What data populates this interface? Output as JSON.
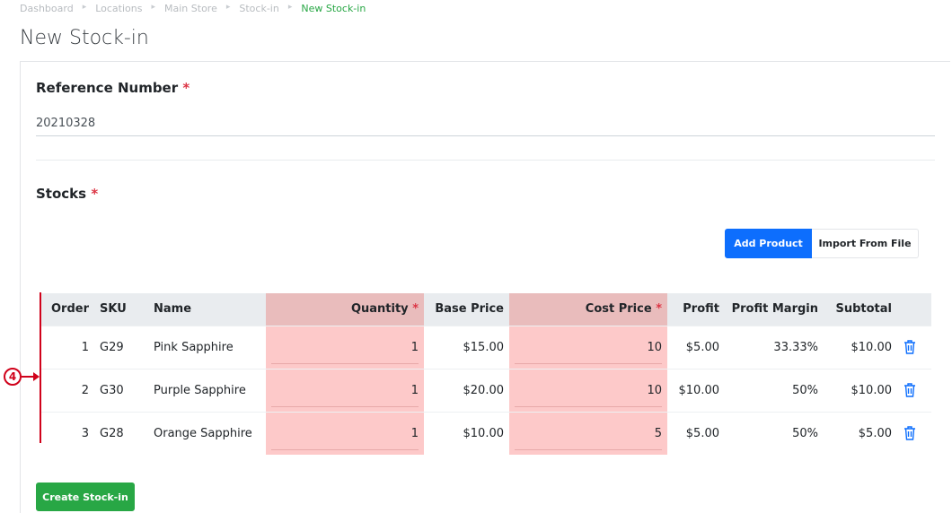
{
  "breadcrumb": [
    "Dashboard",
    "Locations",
    "Main Store",
    "Stock-in",
    "New Stock-in"
  ],
  "page_title": "New Stock-in",
  "form": {
    "reference_label": "Reference Number",
    "reference_value": "20210328",
    "stocks_label": "Stocks",
    "required_mark": "*"
  },
  "buttons": {
    "add_product": "Add Product",
    "import_file": "Import From File",
    "create": "Create Stock-in"
  },
  "table": {
    "headers": {
      "order": "Order",
      "sku": "SKU",
      "name": "Name",
      "quantity": "Quantity",
      "base_price": "Base Price",
      "cost_price": "Cost Price",
      "profit": "Profit",
      "profit_margin": "Profit Margin",
      "subtotal": "Subtotal"
    },
    "rows": [
      {
        "order": "1",
        "sku": "G29",
        "name": "Pink Sapphire",
        "quantity": "1",
        "base_price": "$15.00",
        "cost_price": "10",
        "profit": "$5.00",
        "profit_margin": "33.33%",
        "subtotal": "$10.00"
      },
      {
        "order": "2",
        "sku": "G30",
        "name": "Purple Sapphire",
        "quantity": "1",
        "base_price": "$20.00",
        "cost_price": "10",
        "profit": "$10.00",
        "profit_margin": "50%",
        "subtotal": "$10.00"
      },
      {
        "order": "3",
        "sku": "G28",
        "name": "Orange Sapphire",
        "quantity": "1",
        "base_price": "$10.00",
        "cost_price": "5",
        "profit": "$5.00",
        "profit_margin": "50%",
        "subtotal": "$5.00"
      }
    ]
  },
  "annotation": {
    "marker_number": "4"
  },
  "colors": {
    "primary": "#0d6efd",
    "success": "#28a745",
    "danger": "#dc3545",
    "highlight": "#fdc9c9",
    "annotation": "#d0021b"
  }
}
